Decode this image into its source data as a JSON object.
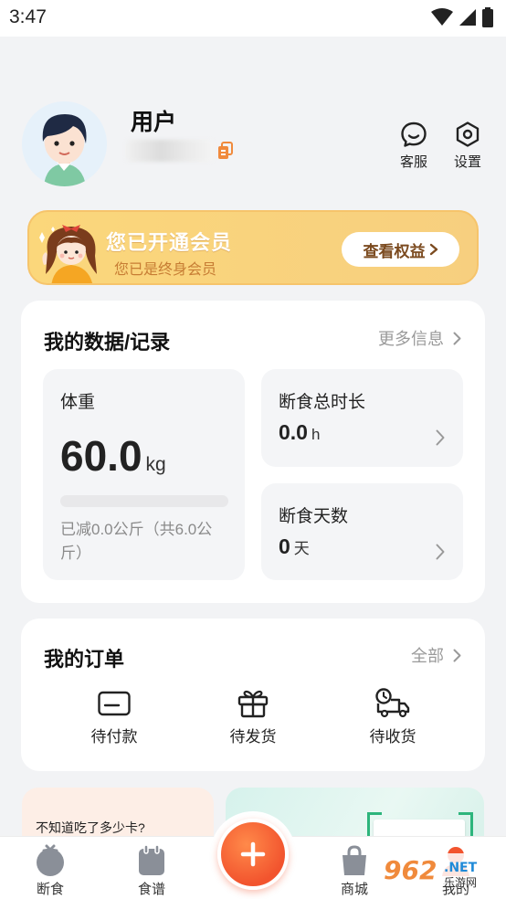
{
  "status_bar": {
    "time": "3:47"
  },
  "profile": {
    "username": "用户",
    "actions": [
      {
        "label": "客服",
        "icon": "chat-bubble-icon"
      },
      {
        "label": "设置",
        "icon": "settings-hexagon-icon"
      }
    ]
  },
  "member": {
    "title": "您已开通会员",
    "subtitle": "您已是终身会员",
    "button": "查看权益"
  },
  "data_card": {
    "title": "我的数据/记录",
    "more": "更多信息",
    "weight": {
      "label": "体重",
      "value": "60.0",
      "unit": "kg",
      "progress": 0,
      "note": "已减0.0公斤（共6.0公斤）"
    },
    "fasting_total": {
      "label": "断食总时长",
      "value": "0.0",
      "unit": "h"
    },
    "fasting_days": {
      "label": "断食天数",
      "value": "0",
      "unit": "天"
    }
  },
  "orders_card": {
    "title": "我的订单",
    "more": "全部",
    "items": [
      {
        "label": "待付款",
        "icon": "card-icon"
      },
      {
        "label": "待发货",
        "icon": "gift-icon"
      },
      {
        "label": "待收货",
        "icon": "delivery-truck-icon"
      }
    ]
  },
  "promo": {
    "left_text": "不知道吃了多少卡?"
  },
  "bottom_nav": {
    "items": [
      {
        "label": "断食",
        "icon": "tomato-icon"
      },
      {
        "label": "食谱",
        "icon": "recipe-book-icon"
      },
      {
        "label": "商城",
        "icon": "shopping-bag-icon"
      },
      {
        "label": "我的",
        "icon": "profile-icon"
      }
    ]
  },
  "colors": {
    "accent": "#f2542e",
    "member_banner": "#f9d37d",
    "background": "#f2f3f5"
  },
  "watermark": "962 NET 乐游网"
}
